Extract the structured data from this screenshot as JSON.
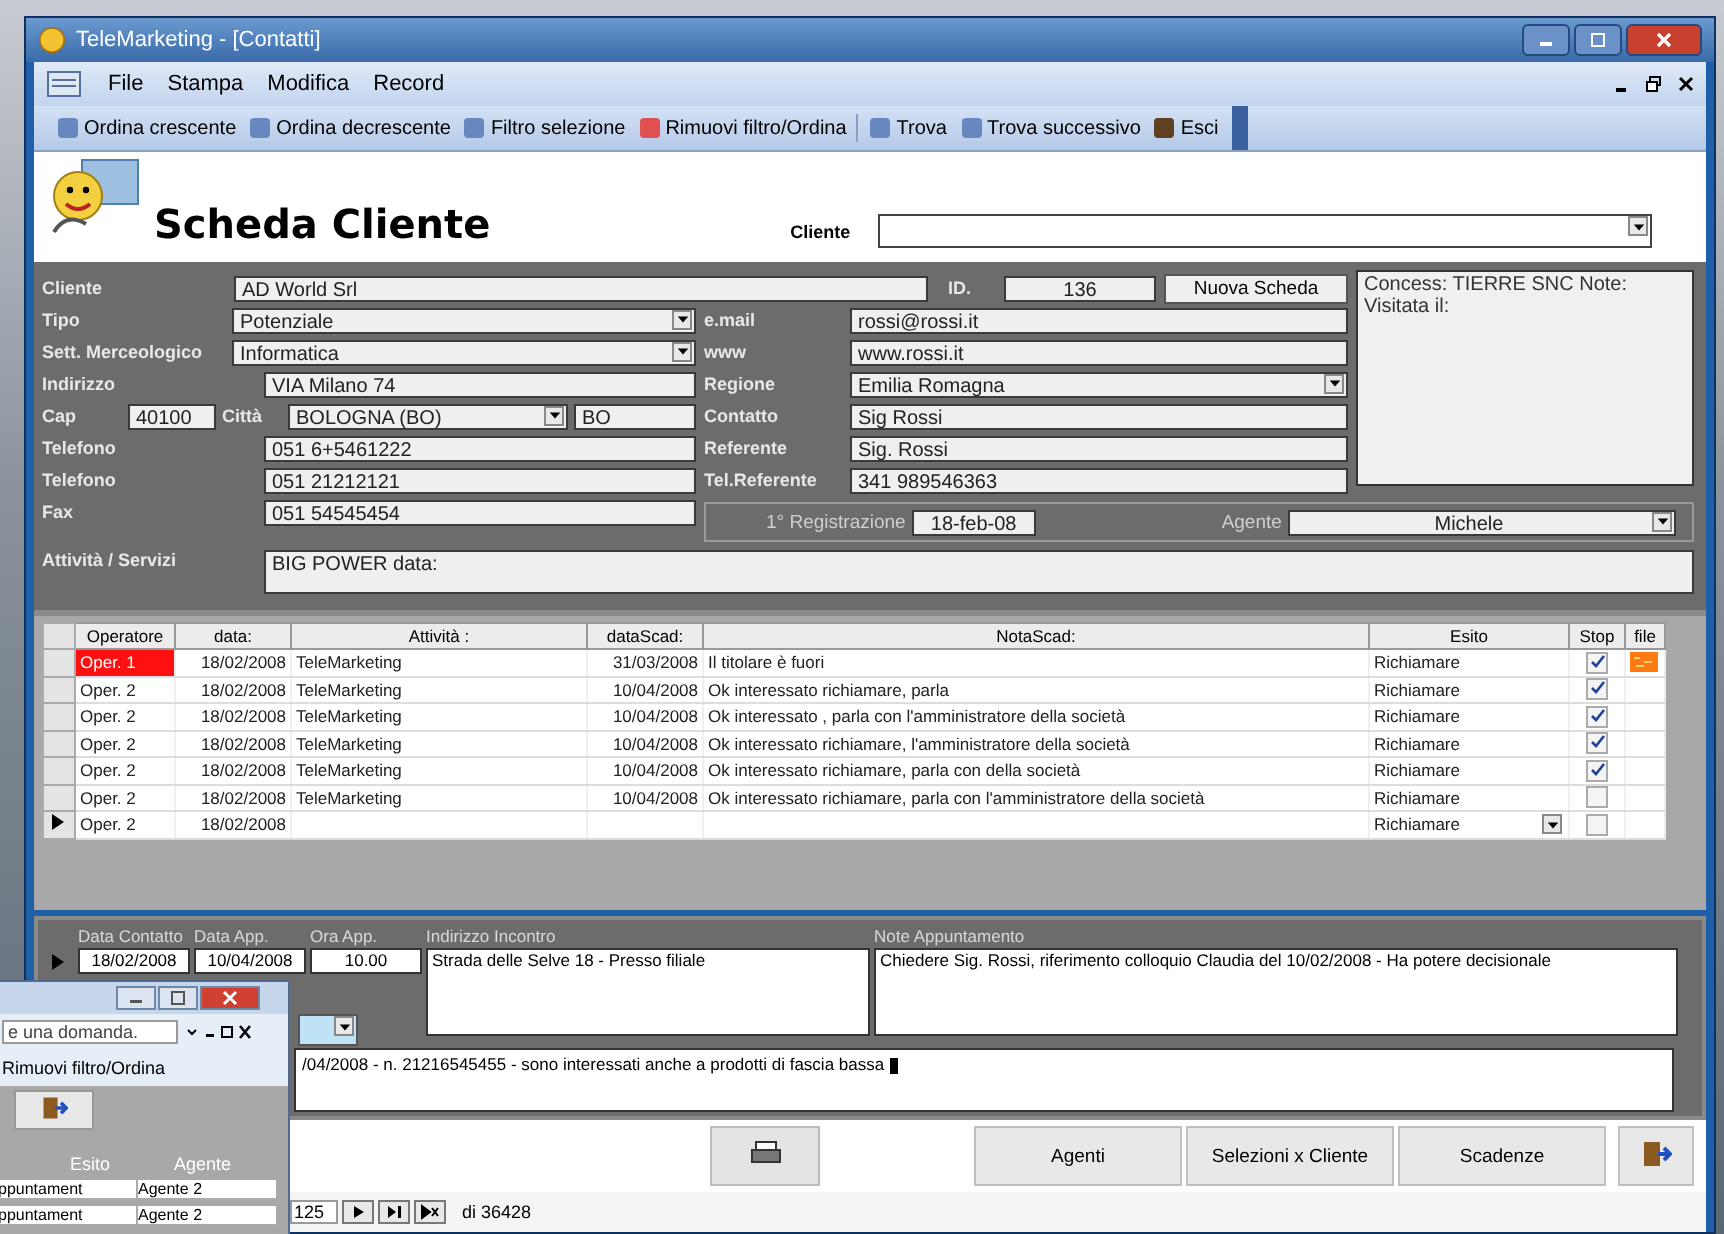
{
  "window": {
    "title": "TeleMarketing - [Contatti]"
  },
  "menu": [
    "File",
    "Stampa",
    "Modifica",
    "Record"
  ],
  "toolbar": [
    "Ordina crescente",
    "Ordina decrescente",
    "Filtro selezione",
    "Rimuovi filtro/Ordina",
    "Trova",
    "Trova successivo",
    "Esci"
  ],
  "header": {
    "title": "Scheda Cliente",
    "cliente_label": "Cliente"
  },
  "client_row": {
    "label": "Cliente",
    "value": "AD World  Srl",
    "id_label": "ID.",
    "id_value": "136",
    "new_button": "Nuova Scheda"
  },
  "left_fields": [
    {
      "kind": "select",
      "label": "Tipo",
      "value": "Potenziale"
    },
    {
      "kind": "select",
      "label": "Sett. Merceologico",
      "value": "Informatica"
    },
    {
      "kind": "text",
      "label": "Indirizzo",
      "value": "VIA Milano 74"
    },
    {
      "kind": "cap",
      "label": "Cap",
      "value": "40100",
      "city_label": "Città",
      "city": "BOLOGNA (BO)",
      "province": "BO"
    },
    {
      "kind": "text",
      "label": "Telefono",
      "value": "051 6+5461222"
    },
    {
      "kind": "text",
      "label": "Telefono",
      "value": "051 21212121"
    },
    {
      "kind": "text",
      "label": "Fax",
      "value": "051 54545454"
    }
  ],
  "right_fields": [
    {
      "kind": "text",
      "label": "e.mail",
      "value": "rossi@rossi.it"
    },
    {
      "kind": "text",
      "label": "www",
      "value": "www.rossi.it"
    },
    {
      "kind": "select",
      "label": "Regione",
      "value": "Emilia Romagna"
    },
    {
      "kind": "text",
      "label": "Contatto",
      "value": "Sig Rossi"
    },
    {
      "kind": "text",
      "label": "Referente",
      "value": "Sig. Rossi"
    },
    {
      "kind": "text",
      "label": "Tel.Referente",
      "value": "341 989546363"
    }
  ],
  "notes": [
    "Concess: TIERRE SNC Note:",
    "Visitata il:"
  ],
  "registration": {
    "label": "1° Registrazione",
    "value": "18-feb-08",
    "agent_label": "Agente",
    "agent": "Michele"
  },
  "activities": {
    "label": "Attività / Servizi",
    "value": "BIG POWER data:"
  },
  "table": {
    "columns": [
      "Operatore",
      "data:",
      "Attività :",
      "dataScad:",
      "NotaScad:",
      "Esito",
      "Stop",
      "file"
    ],
    "rows": [
      {
        "operatore": "Oper. 1",
        "highlighted": true,
        "data": "18/02/2008",
        "attivita": "TeleMarketing",
        "data_scad": "31/03/2008",
        "nota": "Il titolare è fuori",
        "esito": "Richiamare",
        "stop": true,
        "has_file": true,
        "selected": false
      },
      {
        "operatore": "Oper. 2",
        "highlighted": false,
        "data": "18/02/2008",
        "attivita": "TeleMarketing",
        "data_scad": "10/04/2008",
        "nota": "Ok interessato richiamare, parla",
        "esito": "Richiamare",
        "stop": true,
        "has_file": false,
        "selected": false
      },
      {
        "operatore": "Oper. 2",
        "highlighted": false,
        "data": "18/02/2008",
        "attivita": "TeleMarketing",
        "data_scad": "10/04/2008",
        "nota": "Ok interessato , parla con l'amministratore della società",
        "esito": "Richiamare",
        "stop": true,
        "has_file": false,
        "selected": false
      },
      {
        "operatore": "Oper. 2",
        "highlighted": false,
        "data": "18/02/2008",
        "attivita": "TeleMarketing",
        "data_scad": "10/04/2008",
        "nota": "Ok interessato richiamare,   l'amministratore della società",
        "esito": "Richiamare",
        "stop": true,
        "has_file": false,
        "selected": false
      },
      {
        "operatore": "Oper. 2",
        "highlighted": false,
        "data": "18/02/2008",
        "attivita": "TeleMarketing",
        "data_scad": "10/04/2008",
        "nota": "Ok interessato richiamare, parla con  della società",
        "esito": "Richiamare",
        "stop": true,
        "has_file": false,
        "selected": false
      },
      {
        "operatore": "Oper. 2",
        "highlighted": false,
        "data": "18/02/2008",
        "attivita": "TeleMarketing",
        "data_scad": "10/04/2008",
        "nota": "Ok interessato richiamare, parla con l'amministratore della società",
        "esito": "Richiamare",
        "stop": false,
        "has_file": false,
        "selected": false
      },
      {
        "operatore": "Oper. 2",
        "highlighted": false,
        "data": "18/02/2008",
        "esito": "Richiamare",
        "stop": false,
        "has_file": false,
        "selected": true
      }
    ]
  },
  "appointment": {
    "columns": [
      "Data Contatto",
      "Data App.",
      "Ora App.",
      "Indirizzo Incontro",
      "Note Appuntamento"
    ],
    "values": [
      "18/02/2008",
      "10/04/2008",
      "10.00",
      "Strada delle Selve 18 - Presso filiale",
      "Chiedere Sig. Rossi, riferimento colloquio Claudia del 10/02/2008 - Ha potere decisionale"
    ],
    "memo": "/04/2008 - n. 21216545455 - sono interessati anche a prodotti di fascia bassa"
  },
  "buttons": [
    "Agenti",
    "Selezioni x Cliente",
    "Scadenze"
  ],
  "navigator": {
    "record": "125",
    "total": "di 36428"
  },
  "back_window": {
    "search_placeholder": "e una domanda.",
    "toolbar_item": "Rimuovi filtro/Ordina",
    "columns": [
      "Esito",
      "Agente"
    ],
    "rows": [
      [
        "ppuntament",
        "Agente 2"
      ],
      [
        "ppuntament",
        "Agente 2"
      ]
    ]
  }
}
